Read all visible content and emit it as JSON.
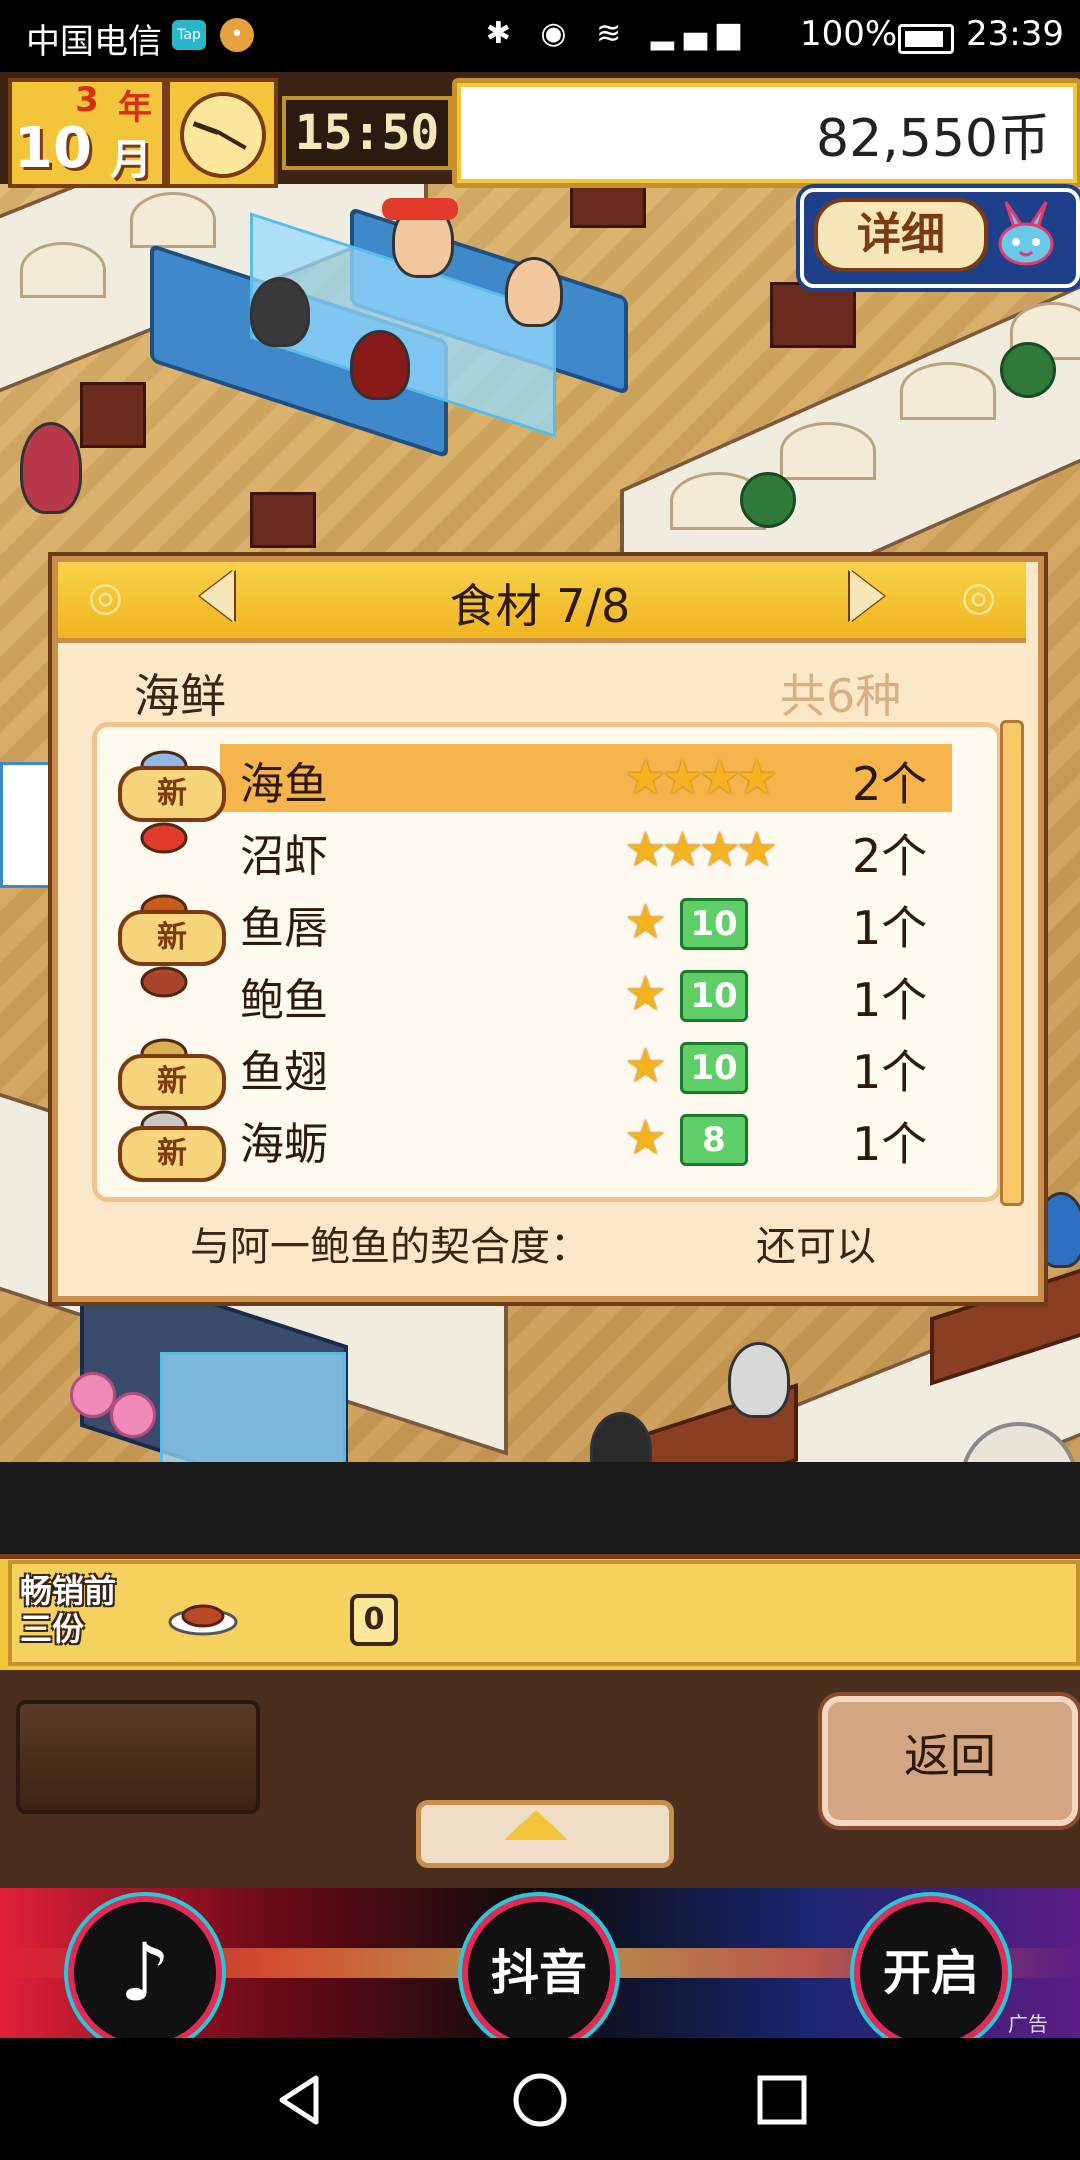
{
  "status_bar": {
    "carrier": "中国电信",
    "tap_badge": "Tap",
    "battery": "100%",
    "time": "23:39"
  },
  "hud": {
    "year": "3",
    "year_label": "年",
    "month": "10",
    "month_label": "月",
    "game_time": "15:50",
    "money": "82,550币"
  },
  "detail_button": {
    "label": "详细"
  },
  "dialog": {
    "title": "食材 7/8",
    "category": "海鲜",
    "category_count": "共6种",
    "compat_label": "与阿一鲍鱼的契合度：",
    "compat_value": "还可以",
    "items": [
      {
        "name": "海鱼",
        "stars": "★★★★",
        "level": "",
        "qty": "2个",
        "new": true,
        "selected": true
      },
      {
        "name": "沼虾",
        "stars": "★★★★",
        "level": "",
        "qty": "2个",
        "new": false,
        "selected": false
      },
      {
        "name": "鱼唇",
        "stars": "★",
        "level": "10",
        "qty": "1个",
        "new": true,
        "selected": false
      },
      {
        "name": "鲍鱼",
        "stars": "★",
        "level": "10",
        "qty": "1个",
        "new": false,
        "selected": false
      },
      {
        "name": "鱼翅",
        "stars": "★",
        "level": "10",
        "qty": "1个",
        "new": true,
        "selected": false
      },
      {
        "name": "海蛎",
        "stars": "★",
        "level": "8",
        "qty": "1个",
        "new": true,
        "selected": false
      }
    ],
    "new_label": "新"
  },
  "bestseller": {
    "label": "畅销前三份",
    "count": "0"
  },
  "buttons": {
    "return": "返回"
  },
  "ad": {
    "douyin": "抖音",
    "open": "开启",
    "tag": "广告"
  },
  "colors": {
    "accent_gold": "#f2c53a",
    "highlight_row": "#f6b54c",
    "level_green": "#5fcf6a",
    "dialog_bg": "#fbe8c8"
  },
  "icons": {
    "clock": "clock-icon",
    "rabbit": "rabbit-mascot-icon",
    "prev": "arrow-left-icon",
    "next": "arrow-right-icon",
    "dish": "dish-icon",
    "tiktok": "tiktok-logo-icon",
    "back": "nav-back-icon",
    "home": "nav-home-icon",
    "recents": "nav-recents-icon"
  }
}
